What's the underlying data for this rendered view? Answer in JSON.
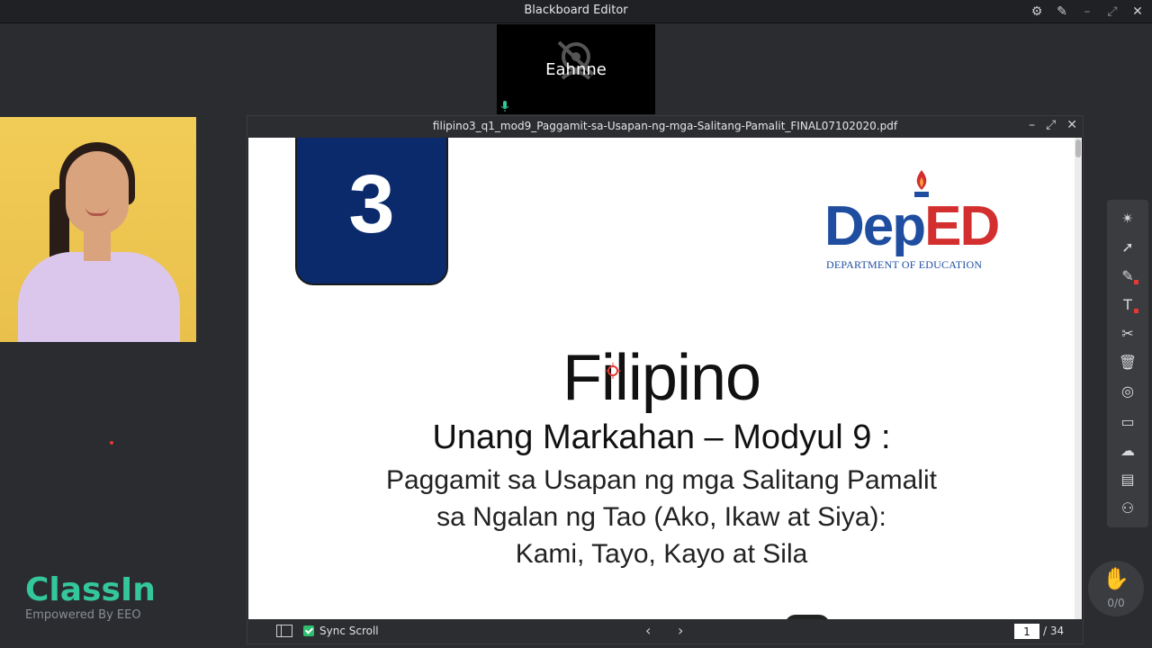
{
  "window": {
    "title": "Blackboard Editor"
  },
  "participant": {
    "name": "Eahnne"
  },
  "brand": {
    "logo": "ClassIn",
    "tagline": "Empowered By EEO"
  },
  "document": {
    "filename": "filipino3_q1_mod9_Paggamit-sa-Usapan-ng-mga-Salitang-Pamalit_FINAL07102020.pdf",
    "grade": "3",
    "logo_text_blue": "Dep",
    "logo_text_red": "ED",
    "logo_sub": "DEPARTMENT OF EDUCATION",
    "title": "Filipino",
    "subtitle": "Unang Markahan – Modyul 9  :",
    "lines": [
      "Paggamit sa Usapan ng mga Salitang Pamalit",
      "sa Ngalan ng Tao (Ako, Ikaw at Siya):",
      "Kami, Tayo, Kayo at Sila"
    ],
    "sync_scroll_label": "Sync Scroll",
    "current_page": "1",
    "total_pages": "/ 34"
  },
  "hand_raise": {
    "count": "0/0"
  },
  "toolbar_icons": [
    "laser-pointer-icon",
    "select-icon",
    "pen-icon",
    "text-icon",
    "scissors-icon",
    "trash-icon",
    "eraser-icon",
    "chat-icon",
    "cloud-icon",
    "toolbox-icon",
    "users-icon"
  ],
  "colors": {
    "accent_green": "#34c79b",
    "deped_blue": "#1f4ea0",
    "deped_red": "#d32f2f",
    "grade_box": "#0a2a6b"
  }
}
